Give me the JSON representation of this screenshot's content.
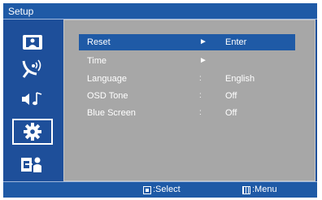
{
  "title": "Setup",
  "sidebar": {
    "items": [
      {
        "icon": "picture-icon",
        "selected": false
      },
      {
        "icon": "antenna-icon",
        "selected": false
      },
      {
        "icon": "sound-icon",
        "selected": false
      },
      {
        "icon": "gear-icon",
        "selected": true
      },
      {
        "icon": "person-icon",
        "selected": false
      }
    ]
  },
  "menu": {
    "rows": [
      {
        "label": "Reset",
        "separator": "►",
        "value": "Enter",
        "selected": true
      },
      {
        "label": "Time",
        "separator": "►",
        "value": "",
        "selected": false
      },
      {
        "label": "Language",
        "separator": ":",
        "value": "English",
        "selected": false
      },
      {
        "label": "OSD Tone",
        "separator": ":",
        "value": "Off",
        "selected": false
      },
      {
        "label": "Blue Screen",
        "separator": ":",
        "value": "Off",
        "selected": false
      }
    ]
  },
  "status": {
    "select_label": ":Select",
    "menu_label": ":Menu"
  },
  "colors": {
    "frame": "#1e4f9a",
    "highlight": "#1f5aa6",
    "panel": "#a7a7a7",
    "text": "#ffffff"
  }
}
